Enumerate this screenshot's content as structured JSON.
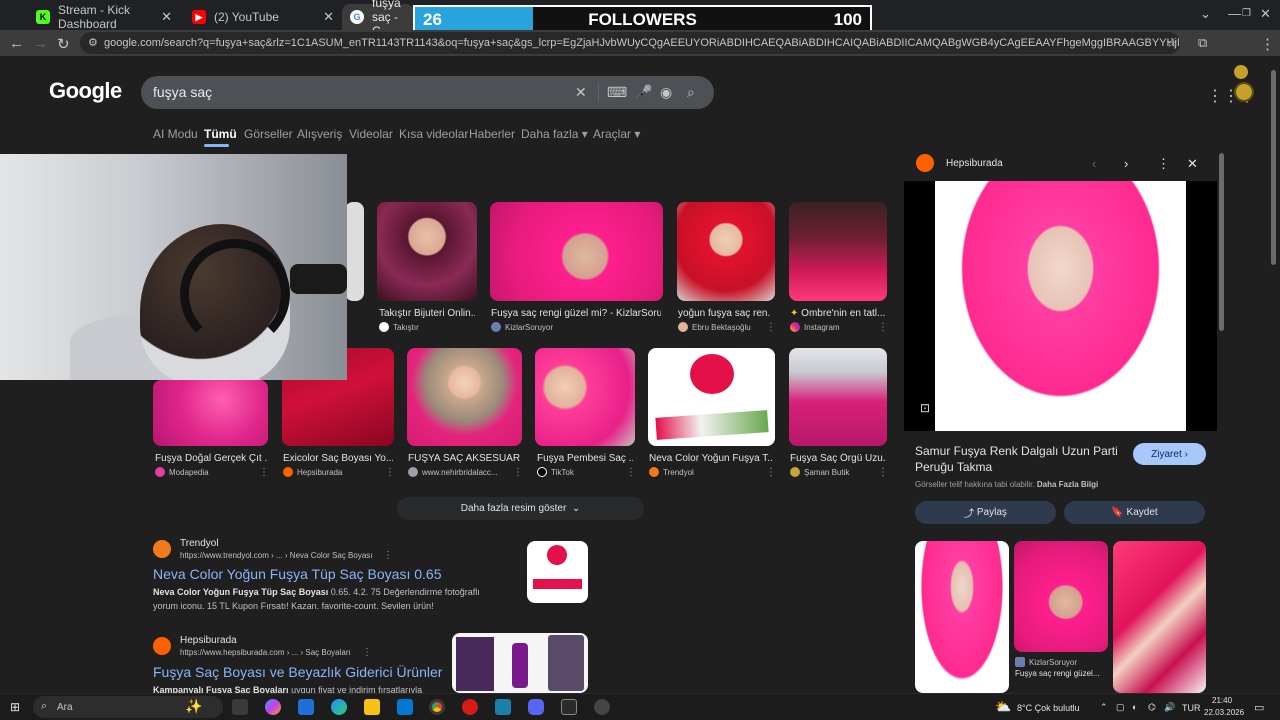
{
  "browser": {
    "tabs": [
      {
        "label": "Stream - Kick Dashboard",
        "favicon": "kick-icon",
        "color": "#53fc18"
      },
      {
        "label": "(2) YouTube",
        "favicon": "youtube-icon",
        "color": "#ff0000"
      },
      {
        "label": "fuşya saç - G",
        "favicon": "google-icon",
        "color": "#ffffff"
      }
    ],
    "url": "google.com/search?q=fuşya+saç&rlz=1C1ASUM_enTR1143TR1143&oq=fuşya+saç&gs_lcrp=EgZjaHJvbWUyCQgAEEUYORiABDIHCAEQABiABDIHCAIQABiABDIICAMQABgWGB4yCAgEEAAYFhgeMggIBRAAGBYYHjIICAYQABgWGB4yCAgHEAAYFhgeMggICB..."
  },
  "overlay": {
    "current": "26",
    "label": "FOLLOWERS",
    "goal": "100",
    "progress": 0.26
  },
  "google": {
    "logo": "Google",
    "query": "fuşya saç",
    "nav_tabs": [
      "AI Modu",
      "Tümü",
      "Görseller",
      "Alışveriş",
      "Videolar",
      "Kısa videolar",
      "Haberler",
      "Daha fazla",
      "Araçlar"
    ]
  },
  "images_row1": [
    {
      "caption": "Takıştır Bijuteri Onlin...",
      "source": "Takıştır"
    },
    {
      "caption": "Fuşya saç rengi güzel mi? - KizlarSoru...",
      "source": "KizlarSoruyor"
    },
    {
      "caption": "yoğun fuşya saç ren...",
      "source": "Ebru Bektaşoğlu"
    },
    {
      "caption": "Ombre'nin en tatl...",
      "source": "Instagram"
    }
  ],
  "images_row2": [
    {
      "caption": "Fuşya Doğal Gerçek Çıt ...",
      "source": "Modapedia"
    },
    {
      "caption": "Exicolor Saç Boyası Yo...",
      "source": "Hepsiburada"
    },
    {
      "caption": "FUŞYA SAÇ AKSESUARI",
      "source": "www.nehirbridalacc..."
    },
    {
      "caption": "Fuşya Pembesi Saç ...",
      "source": "TikTok"
    },
    {
      "caption": "Neva Color Yoğun Fuşya T...",
      "source": "Trendyol"
    },
    {
      "caption": "Fuşya Saç Örgü Uzu...",
      "source": "Şaman Butik"
    }
  ],
  "more_images": "Daha fazla resim göster",
  "results": [
    {
      "site": "Trendyol",
      "url": "https://www.trendyol.com › ... › Neva Color Saç Boyası",
      "title": "Neva Color Yoğun Fuşya Tüp Saç Boyası 0.65",
      "snippet_bold": "Neva Color Yoğun Fuşya Tüp Saç Boyası",
      "snippet": " 0.65. 4.2. 75 Değerlendirme fotoğraflı yorum iconu. 15 TL Kupon Fırsatı! Kazan. favorite-count. Sevilen ürün!"
    },
    {
      "site": "Hepsiburada",
      "url": "https://www.hepsiburada.com › ... › Saç Boyaları",
      "title": "Fuşya Saç Boyası ve Beyazlık Giderici Ürünler",
      "snippet_bold": "Kampanyalı Fuşya Saç Boyaları",
      "snippet": " uygun fiyat ve indirim fırsatlarıyla"
    }
  ],
  "panel": {
    "source": "Hepsiburada",
    "title": "Samur Fuşya Renk Dalgalı Uzun Parti Peruğu Takma",
    "visit": "Ziyaret",
    "note": "Görseller telif hakkına tabi olabilir.",
    "note_link": "Daha Fazla Bilgi",
    "share": "Paylaş",
    "save": "Kaydet",
    "related_source": "KizlarSoruyor",
    "related_caption": "Fuşya saç rengi güzel..."
  },
  "taskbar": {
    "search": "Ara",
    "weather": "8°C  Çok bulutlu",
    "lang": "TUR",
    "time": "21:40",
    "date": "22.03.2026"
  }
}
